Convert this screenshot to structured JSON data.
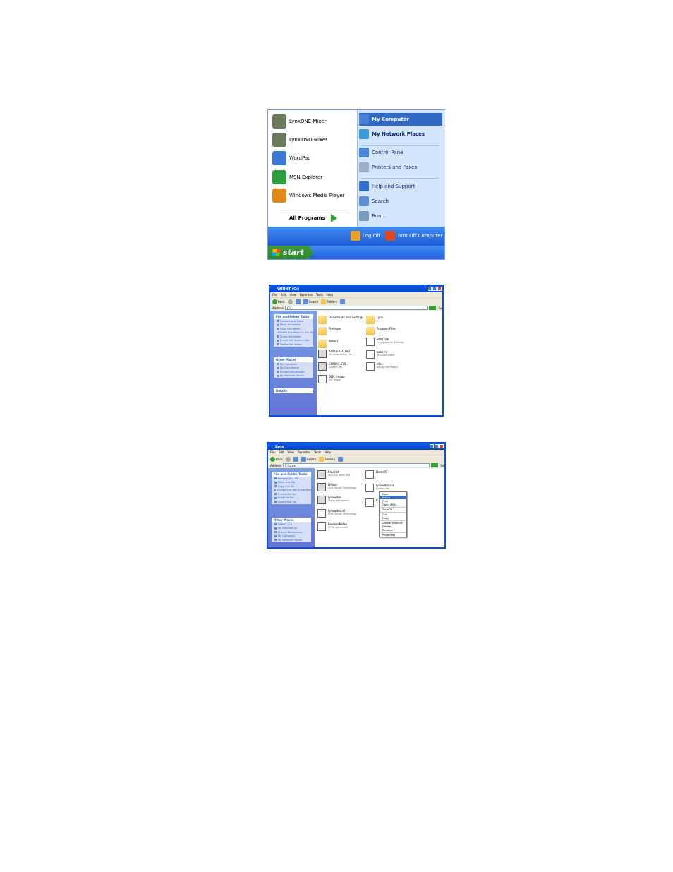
{
  "start_menu": {
    "pinned": [
      {
        "label": "LynxONE Mixer",
        "icon": "mixer-icon",
        "color": "#6a7a5a"
      },
      {
        "label": "LynxTWO Mixer",
        "icon": "mixer-icon",
        "color": "#6a7a5a"
      },
      {
        "label": "WordPad",
        "icon": "wordpad-icon",
        "color": "#3a7ad6"
      },
      {
        "label": "MSN Explorer",
        "icon": "msn-butterfly-icon",
        "color": "#2f9f3f"
      },
      {
        "label": "Windows Media Player",
        "icon": "media-player-icon",
        "color": "#e08a1a"
      }
    ],
    "all_programs": "All Programs",
    "right": [
      {
        "label": "My Computer",
        "icon": "my-computer-icon"
      },
      {
        "label": "My Network Places",
        "icon": "network-places-icon"
      },
      {
        "label": "Control Panel",
        "icon": "control-panel-icon"
      },
      {
        "label": "Printers and Faxes",
        "icon": "printer-icon"
      },
      {
        "label": "Help and Support",
        "icon": "help-icon"
      },
      {
        "label": "Search",
        "icon": "search-icon"
      },
      {
        "label": "Run...",
        "icon": "run-icon"
      }
    ],
    "log_off": "Log Off",
    "turn_off": "Turn Off Computer",
    "start": "start"
  },
  "window1": {
    "title": "WINNT (C:)",
    "menu": [
      "File",
      "Edit",
      "View",
      "Favorites",
      "Tools",
      "Help"
    ],
    "toolbar": {
      "back": "Back",
      "search": "Search",
      "folders": "Folders"
    },
    "address_label": "Address",
    "address": "C:\\",
    "go": "Go",
    "tasks_header": "File and Folder Tasks",
    "tasks": [
      "Rename this folder",
      "Move this folder",
      "Copy this folder",
      "Publish this folder to the Web",
      "Share this folder",
      "E-mail this folder's files",
      "Delete this folder"
    ],
    "other_header": "Other Places",
    "other": [
      "My Computer",
      "My Documents",
      "Shared Documents",
      "My Network Places"
    ],
    "details_header": "Details",
    "files": [
      {
        "name": "Documents and Settings",
        "sub": "",
        "type": "folder"
      },
      {
        "name": "Lynx",
        "sub": "",
        "type": "folder"
      },
      {
        "name": "Prelinger",
        "sub": "",
        "type": "folder"
      },
      {
        "name": "Program Files",
        "sub": "",
        "type": "folder"
      },
      {
        "name": "WINNT",
        "sub": "",
        "type": "folder"
      },
      {
        "name": "AUTOEXEC.BAT",
        "sub": "Windows Batch File",
        "type": "sys"
      },
      {
        "name": "BOOT.INI",
        "sub": "Configuration Settings",
        "type": "doc"
      },
      {
        "name": "CONFIG.SYS",
        "sub": "System file",
        "type": "sys"
      },
      {
        "name": "boot.ini",
        "sub": "Text Document",
        "type": "doc"
      },
      {
        "name": "ONC image",
        "sub": "GIF Image",
        "type": "doc"
      },
      {
        "name": "nfo",
        "sub": "Setup Information",
        "type": "doc"
      }
    ]
  },
  "window2": {
    "title": "Lynx",
    "menu": [
      "File",
      "Edit",
      "View",
      "Favorites",
      "Tools",
      "Help"
    ],
    "toolbar": {
      "back": "Back",
      "search": "Search",
      "folders": "Folders"
    },
    "address_label": "Address",
    "address": "C:\\Lynx",
    "go": "Go",
    "tasks_header": "File and Folder Tasks",
    "tasks": [
      "Rename this file",
      "Move this file",
      "Copy this file",
      "Publish this file to the Web",
      "E-mail this file",
      "Print this file",
      "Delete this file"
    ],
    "other_header": "Other Places",
    "other": [
      "WINNT (C:)",
      "My Documents",
      "Shared Documents",
      "My Computer",
      "My Network Places"
    ],
    "files": [
      {
        "name": "ClearInf",
        "sub": "MS-DOS Batch File",
        "type": "sys"
      },
      {
        "name": "DemoIS",
        "sub": "",
        "type": "doc"
      },
      {
        "name": "LMixer",
        "sub": "Lynx Studio Technology",
        "type": "sys"
      },
      {
        "name": "lynxwdm",
        "sub": "Setup Information",
        "type": "sys"
      },
      {
        "name": "lynxwdm.sys",
        "sub": "System file",
        "type": "doc"
      },
      {
        "name": "lynxwdm.dll",
        "sub": "Lynx Studio Technology",
        "type": "doc"
      },
      {
        "name": "Ic",
        "sub": "",
        "type": "doc"
      },
      {
        "name": "ReleaseNotes",
        "sub": "HTML Document",
        "type": "doc"
      }
    ],
    "context_menu": [
      "Open",
      "Install",
      "Print",
      "Open With...",
      "Send To",
      "Cut",
      "Copy",
      "Create Shortcut",
      "Delete",
      "Rename",
      "Properties"
    ]
  }
}
